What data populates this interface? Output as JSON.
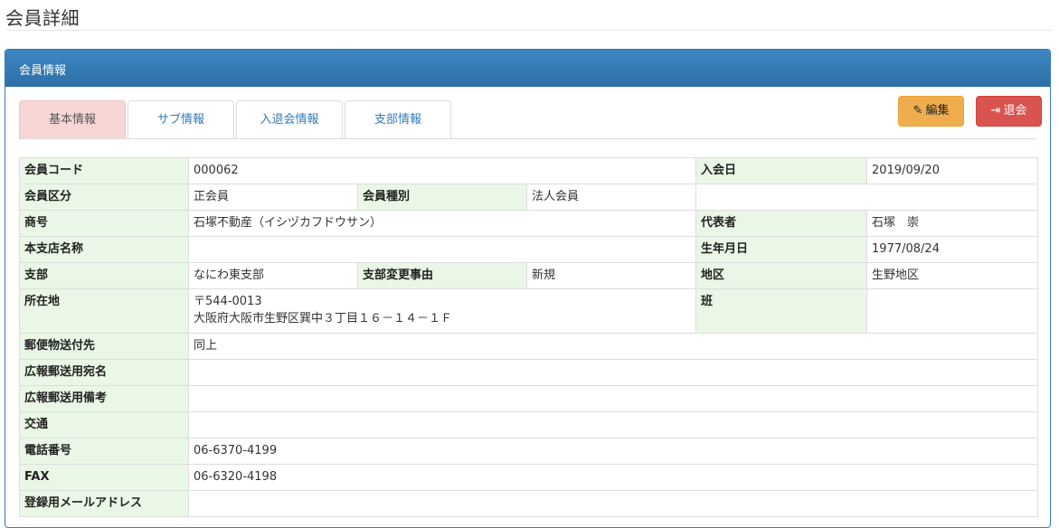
{
  "page": {
    "title": "会員詳細"
  },
  "panel": {
    "heading": "会員情報"
  },
  "tabs": [
    {
      "label": "基本情報",
      "active": true
    },
    {
      "label": "サブ情報",
      "active": false
    },
    {
      "label": "入退会情報",
      "active": false
    },
    {
      "label": "支部情報",
      "active": false
    }
  ],
  "buttons": {
    "edit": "編集",
    "leave": "退会"
  },
  "fields": {
    "member_code": {
      "label": "会員コード",
      "value": "000062"
    },
    "join_date": {
      "label": "入会日",
      "value": "2019/09/20"
    },
    "member_class": {
      "label": "会員区分",
      "value": "正会員"
    },
    "member_type": {
      "label": "会員種別",
      "value": "法人会員"
    },
    "trade_name": {
      "label": "商号",
      "value": "石塚不動産（イシヅカフドウサン）"
    },
    "representative": {
      "label": "代表者",
      "value": "石塚　崇"
    },
    "branch_name": {
      "label": "本支店名称",
      "value": ""
    },
    "birth_date": {
      "label": "生年月日",
      "value": "1977/08/24"
    },
    "branch": {
      "label": "支部",
      "value": "なにわ東支部"
    },
    "branch_change_reason": {
      "label": "支部変更事由",
      "value": "新規"
    },
    "district": {
      "label": "地区",
      "value": "生野地区"
    },
    "address": {
      "label": "所在地",
      "postal": "〒544-0013",
      "line": "大阪府大阪市生野区巽中３丁目１６－１４－１Ｆ"
    },
    "group": {
      "label": "班",
      "value": ""
    },
    "mail_destination": {
      "label": "郵便物送付先",
      "value": "同上"
    },
    "pr_mail_name": {
      "label": "広報郵送用宛名",
      "value": ""
    },
    "pr_mail_note": {
      "label": "広報郵送用備考",
      "value": ""
    },
    "transport": {
      "label": "交通",
      "value": ""
    },
    "phone": {
      "label": "電話番号",
      "value": "06-6370-4199"
    },
    "fax": {
      "label": "FAX",
      "value": "06-6320-4198"
    },
    "email": {
      "label": "登録用メールアドレス",
      "value": ""
    }
  }
}
